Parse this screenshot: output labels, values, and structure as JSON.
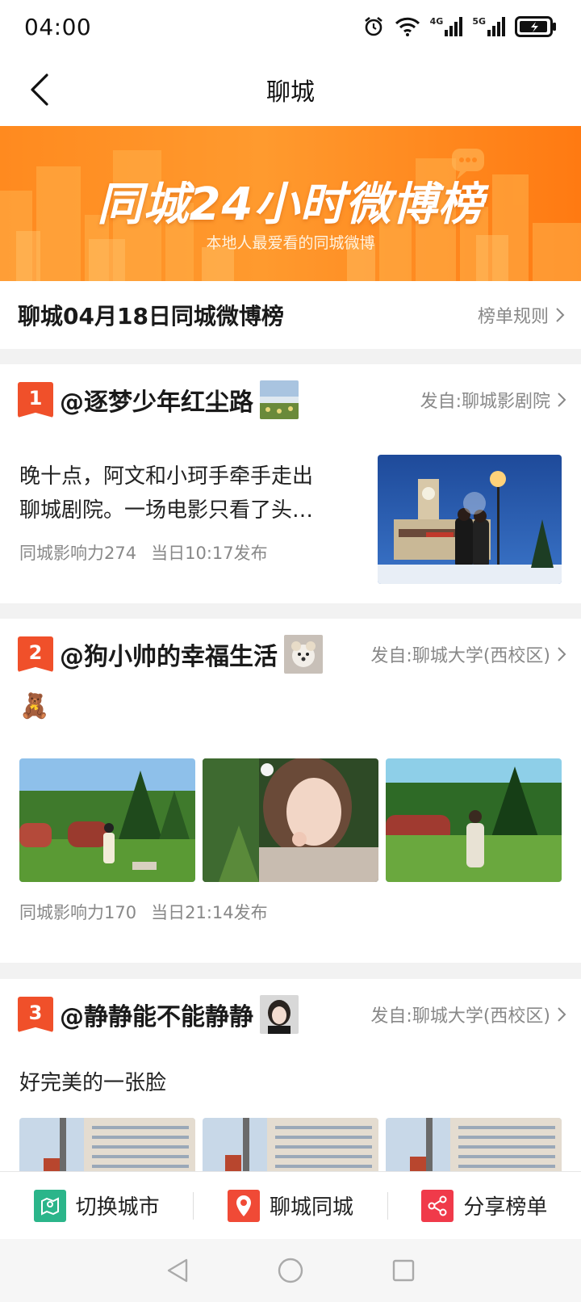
{
  "status_bar": {
    "time": "04:00",
    "signal_4g": "4G",
    "signal_5g": "5G"
  },
  "nav": {
    "title": "聊城"
  },
  "banner": {
    "title": "同城24小时微博榜",
    "subtitle": "本地人最爱看的同城微博"
  },
  "rank_header": {
    "title": "聊城04月18日同城微博榜",
    "rules_label": "榜单规则"
  },
  "posts": [
    {
      "rank": "1",
      "username": "@逐梦少年红尘路",
      "source": "发自:聊城影剧院",
      "text_line1": "晚十点，阿文和小珂手牵手走出",
      "text_line2": "聊城剧院。一场电影只看了头…",
      "influence": "同城影响力274",
      "time": "当日10:17发布"
    },
    {
      "rank": "2",
      "username": "@狗小帅的幸福生活",
      "source": "发自:聊城大学(西校区)",
      "emoji": "🧸",
      "influence": "同城影响力170",
      "time": "当日21:14发布"
    },
    {
      "rank": "3",
      "username": "@静静能不能静静",
      "source": "发自:聊城大学(西校区)",
      "text": "好完美的一张脸"
    }
  ],
  "toolbar": {
    "switch_city": "切换城市",
    "local_city": "聊城同城",
    "share_list": "分享榜单"
  },
  "colors": {
    "brand_orange": "#ff8a1f",
    "rank_badge": "#f0502a",
    "switch_city_icon": "#2bb58a",
    "local_city_icon": "#f04a36",
    "share_icon": "#f03a4a"
  }
}
